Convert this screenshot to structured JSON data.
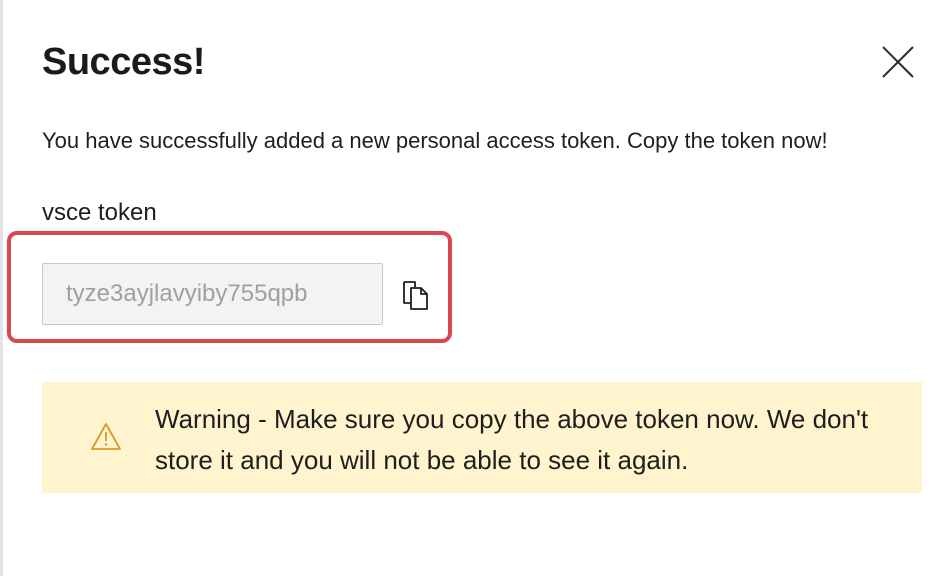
{
  "dialog": {
    "title": "Success!",
    "message": "You have successfully added a new personal access token. Copy the token now!",
    "token_name": "vsce token",
    "token_value": "tyze3ayjlavyiby755qpb",
    "close_icon": "close-icon",
    "copy_icon": "copy-icon"
  },
  "warning": {
    "icon": "warning-icon",
    "text": "Warning - Make sure you copy the above token now. We don't store it and you will not be able to see it again."
  },
  "colors": {
    "highlight_border": "#d9484f",
    "warning_background": "#fff4ce",
    "warning_icon": "#d89a2b",
    "input_background": "#f3f3f3"
  }
}
